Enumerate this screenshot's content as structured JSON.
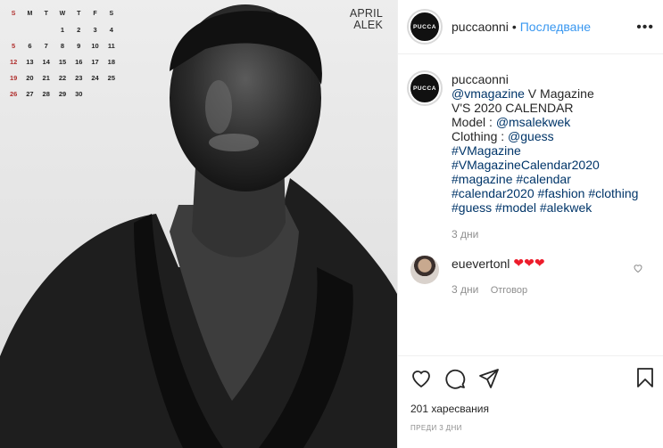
{
  "calendar": {
    "weekdays": [
      "S",
      "M",
      "T",
      "W",
      "T",
      "F",
      "S"
    ],
    "rows": [
      [
        "",
        "",
        "",
        "1",
        "2",
        "3",
        "4"
      ],
      [
        "5",
        "6",
        "7",
        "8",
        "9",
        "10",
        "11"
      ],
      [
        "12",
        "13",
        "14",
        "15",
        "16",
        "17",
        "18"
      ],
      [
        "19",
        "20",
        "21",
        "22",
        "23",
        "24",
        "25"
      ],
      [
        "26",
        "27",
        "28",
        "29",
        "30",
        "",
        ""
      ]
    ],
    "month": "APRIL",
    "name": "ALEK",
    "sunday_color": "#b0302e"
  },
  "post": {
    "avatar_text": "PUCCA",
    "username": "puccaonni",
    "dot": "•",
    "follow_label": "Последване",
    "more_icon": "•••",
    "caption": {
      "username": "puccaonni",
      "lines": [
        {
          "type": "mixed",
          "parts": [
            {
              "t": "@vmagazine",
              "link": true
            },
            {
              "t": " V Magazine",
              "link": false
            }
          ]
        },
        {
          "type": "plain",
          "text": "V'S 2020 CALENDAR"
        },
        {
          "type": "mixed",
          "parts": [
            {
              "t": "Model : ",
              "link": false
            },
            {
              "t": "@msalekwek",
              "link": true
            }
          ]
        },
        {
          "type": "mixed",
          "parts": [
            {
              "t": "Clothing : ",
              "link": false
            },
            {
              "t": "@guess",
              "link": true
            }
          ]
        },
        {
          "type": "mixed",
          "parts": [
            {
              "t": "#VMagazine",
              "link": true
            }
          ]
        },
        {
          "type": "mixed",
          "parts": [
            {
              "t": "#VMagazineCalendar2020",
              "link": true
            }
          ]
        },
        {
          "type": "mixed",
          "parts": [
            {
              "t": "#magazine",
              "link": true
            },
            {
              "t": " ",
              "link": false
            },
            {
              "t": "#calendar",
              "link": true
            }
          ]
        },
        {
          "type": "mixed",
          "parts": [
            {
              "t": "#calendar2020",
              "link": true
            },
            {
              "t": " ",
              "link": false
            },
            {
              "t": "#fashion",
              "link": true
            },
            {
              "t": " ",
              "link": false
            },
            {
              "t": "#clothing",
              "link": true
            }
          ]
        },
        {
          "type": "mixed",
          "parts": [
            {
              "t": "#guess",
              "link": true
            },
            {
              "t": " ",
              "link": false
            },
            {
              "t": "#model",
              "link": true
            },
            {
              "t": " ",
              "link": false
            },
            {
              "t": "#alekwek",
              "link": true
            }
          ]
        }
      ],
      "time": "3 дни"
    },
    "comment": {
      "username": "euevertonl",
      "hearts": "❤❤❤",
      "time": "3 дни",
      "reply_label": "Отговор"
    },
    "likes": "201 харесвания",
    "posted": "ПРЕДИ 3 ДНИ",
    "colors": {
      "link": "#003569",
      "follow": "#3897f0",
      "muted": "#8e8e8e",
      "heart": "#ed1c2b"
    },
    "icons": [
      "heart-outline-icon",
      "comment-icon",
      "share-icon",
      "bookmark-icon"
    ]
  }
}
